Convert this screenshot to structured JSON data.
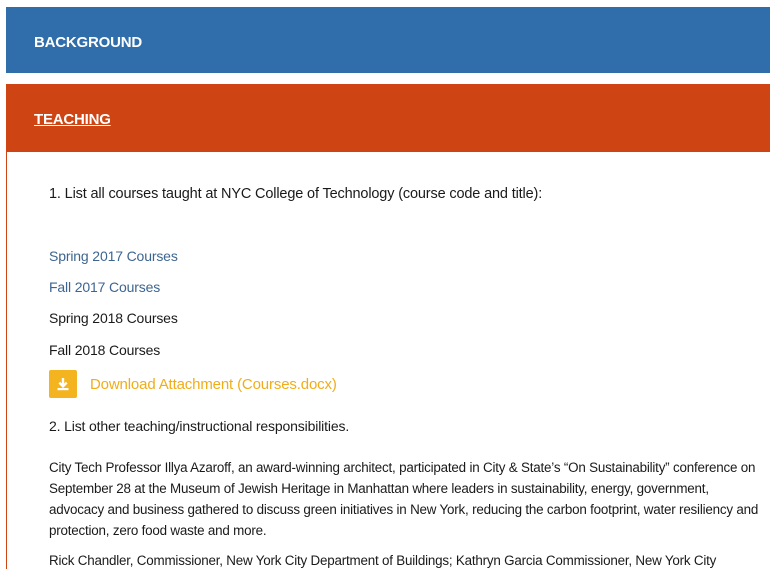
{
  "sections": {
    "background": {
      "label": "BACKGROUND",
      "color": "#2f6dab"
    },
    "teaching": {
      "label": "TEACHING",
      "color": "#cf4413"
    }
  },
  "teaching": {
    "question1": "1. List all courses taught at NYC College of Technology (course code and title):",
    "courses": [
      {
        "label": "Spring 2017 Courses",
        "link": true
      },
      {
        "label": "Fall 2017 Courses",
        "link": true
      },
      {
        "label": "Spring 2018 Courses",
        "link": false
      },
      {
        "label": "Fall 2018 Courses",
        "link": false
      }
    ],
    "download": {
      "label": "Download Attachment (Courses.docx)",
      "icon": "download-icon",
      "color": "#f3b41f"
    },
    "question2": "2. List other teaching/instructional responsibilities.",
    "paragraph1": "City Tech Professor Illya Azaroff, an award-winning architect, participated in City & State’s “On Sustainability” conference on September 28 at the Museum of Jewish Heritage in Manhattan where leaders in sustainability, energy, government, advocacy and business gathered to discuss green initiatives in New York, reducing the carbon footprint, water resiliency and protection, zero food waste and more.",
    "paragraph2": "Rick Chandler, Commissioner, New York City Department of Buildings; Kathryn Garcia Commissioner, New York City"
  }
}
